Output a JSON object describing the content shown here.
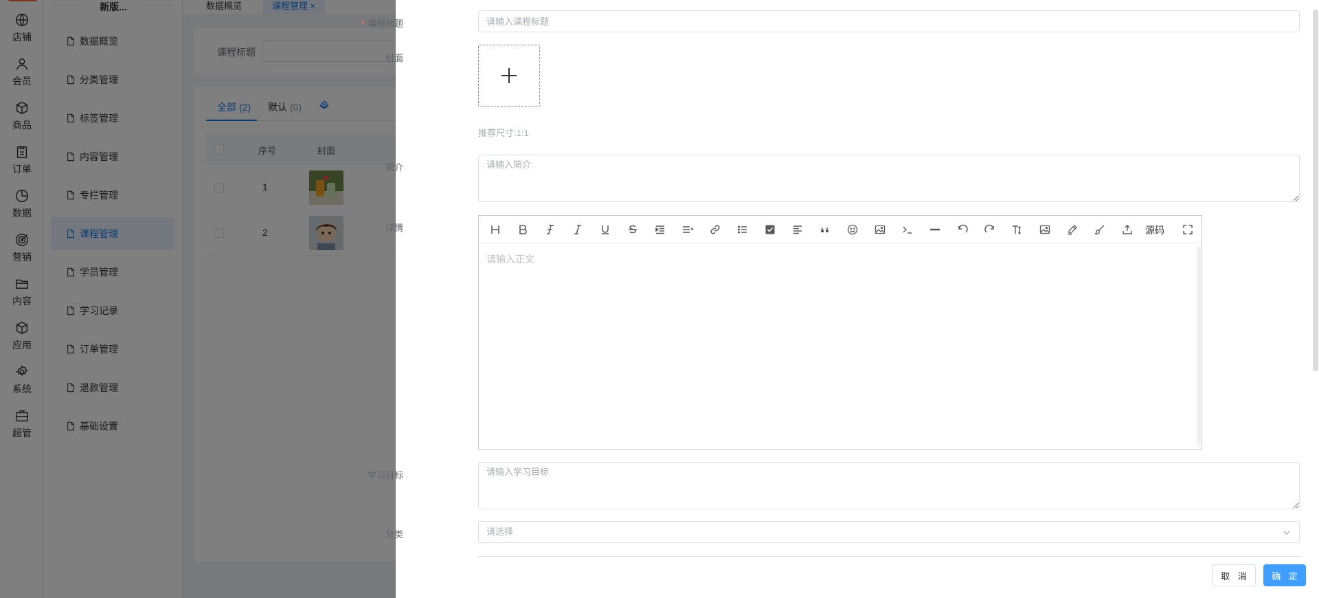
{
  "rail": {
    "items": [
      {
        "label": "店铺",
        "icon": "store-icon"
      },
      {
        "label": "会员",
        "icon": "user-icon"
      },
      {
        "label": "商品",
        "icon": "box-icon"
      },
      {
        "label": "订单",
        "icon": "clipboard-icon"
      },
      {
        "label": "数据",
        "icon": "pie-chart-icon"
      },
      {
        "label": "营销",
        "icon": "target-icon"
      },
      {
        "label": "内容",
        "icon": "folder-icon"
      },
      {
        "label": "应用",
        "icon": "cube-icon"
      },
      {
        "label": "系统",
        "icon": "gear-icon"
      },
      {
        "label": "超管",
        "icon": "briefcase-icon"
      }
    ]
  },
  "subnav": {
    "title": "新版...",
    "items": [
      "数据概览",
      "分类管理",
      "标签管理",
      "内容管理",
      "专栏管理",
      "课程管理",
      "学员管理",
      "学习记录",
      "订单管理",
      "退款管理",
      "基础设置"
    ],
    "active_index": 5
  },
  "top_tabs": [
    {
      "label": "数据概览"
    },
    {
      "label": "课程管理",
      "close": "×"
    }
  ],
  "filter": {
    "label": "课程标题"
  },
  "list": {
    "tabs": [
      {
        "label": "全部",
        "count": "(2)"
      },
      {
        "label": "默认",
        "count": "(0)"
      }
    ],
    "headers": {
      "no": "序号",
      "cover": "封面"
    },
    "rows": [
      {
        "no": "1"
      },
      {
        "no": "2"
      }
    ]
  },
  "drawer": {
    "title_label": "课程标题",
    "title_required": "*",
    "title_placeholder": "请输入课程标题",
    "cover_label": "封面",
    "cover_hint": "推荐尺寸:1:1",
    "intro_label": "简介",
    "intro_placeholder": "请输入简介",
    "detail_label": "详情",
    "detail_placeholder": "请输入正文",
    "editor_source_label": "源码",
    "goal_label": "学习目标",
    "goal_placeholder": "请输入学习目标",
    "category_label": "分类",
    "category_placeholder": "请选择",
    "cancel_label": "取 消",
    "ok_label": "确 定"
  },
  "colors": {
    "primary": "#409eff",
    "nav_active": "#1677e8",
    "required": "#f56c6c"
  }
}
